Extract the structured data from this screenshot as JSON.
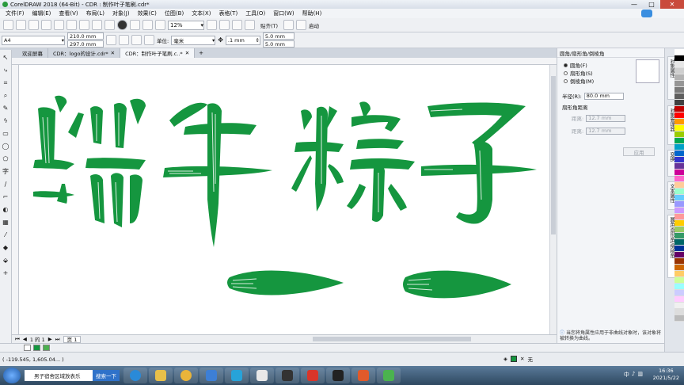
{
  "window": {
    "title": "CorelDRAW 2018 (64-Bit) - CDR : 制作叶子笔刷.cdr*"
  },
  "menu": [
    "文件(F)",
    "编辑(E)",
    "查看(V)",
    "布局(L)",
    "对象(J)",
    "效果(C)",
    "位图(B)",
    "文本(X)",
    "表格(T)",
    "工具(O)",
    "窗口(W)",
    "帮助(H)"
  ],
  "toolbar": {
    "zoom": "12%",
    "snap_label": "贴齐(T)",
    "launch_label": "启动"
  },
  "propbar": {
    "page_size": "A4",
    "width": "210.0 mm",
    "height": "297.0 mm",
    "units_label": "单位:",
    "units_value": "毫米",
    "nudge": ".1 mm",
    "dup_x": "5.0 mm",
    "dup_y": "5.0 mm"
  },
  "tabs": [
    {
      "label": "欢迎屏幕"
    },
    {
      "label": "CDR：logo的设计.cdr*"
    },
    {
      "label": "CDR：制作叶子笔刷.c..*"
    }
  ],
  "pagebar": {
    "page_of": "1 的 1",
    "page_tab": "页 1"
  },
  "status": {
    "coords": "( -119.545, 1,605.04... )",
    "fill_none": "无"
  },
  "docker": {
    "title": "圆角/扇形角/倒棱角",
    "options": [
      "圆角(F)",
      "扇形角(S)",
      "倒棱角(M)"
    ],
    "radius_label": "半径(R):",
    "radius_value": "80.0 mm",
    "corner_label": "扇形角距离",
    "dist1_label": "距离:",
    "dist1_value": "12.7 mm",
    "dist2_label": "距离:",
    "dist2_value": "12.7 mm",
    "apply_label": "应用",
    "info_text": "当您将角属性应用于非曲线对象时，该对象将被转换为曲线。"
  },
  "side_tabs": [
    "对象属性",
    "对象管理器",
    "变换",
    "文本属性",
    "圆角/扇形角/倒棱角"
  ],
  "taskbar": {
    "search_text": "男子宿舍区域放表乐",
    "search_button": "搜索一下",
    "time": "16:36",
    "date": "2021/5/22"
  },
  "colors": {
    "brand_green": "#15963f",
    "accent_blue": "#2f72c9"
  },
  "canvas": {
    "artwork_text": "端午粽子"
  }
}
